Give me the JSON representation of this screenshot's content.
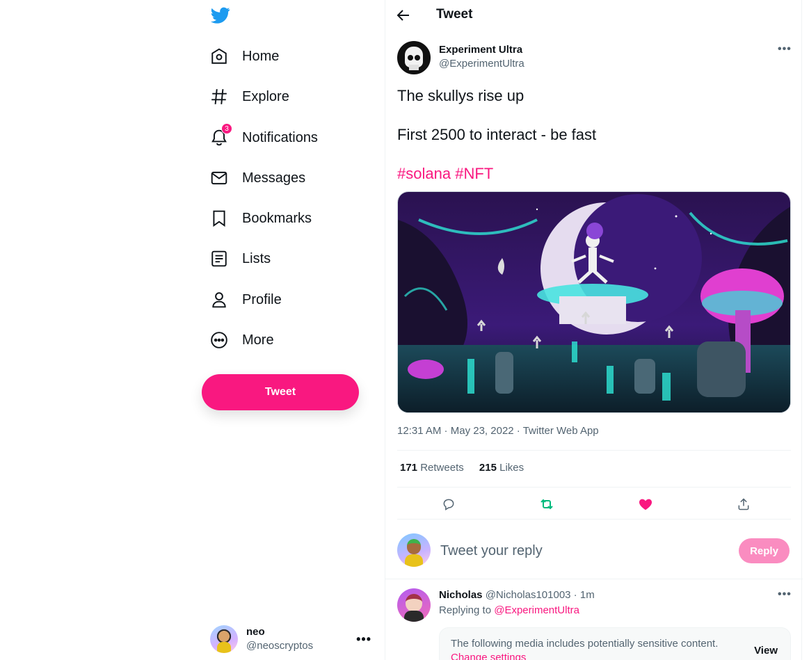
{
  "sidebar": {
    "items": [
      {
        "label": "Home",
        "icon": "home-icon"
      },
      {
        "label": "Explore",
        "icon": "hashtag-icon"
      },
      {
        "label": "Notifications",
        "icon": "bell-icon",
        "badge": "3"
      },
      {
        "label": "Messages",
        "icon": "envelope-icon"
      },
      {
        "label": "Bookmarks",
        "icon": "bookmark-icon"
      },
      {
        "label": "Lists",
        "icon": "list-icon"
      },
      {
        "label": "Profile",
        "icon": "person-icon"
      },
      {
        "label": "More",
        "icon": "more-circle-icon"
      }
    ],
    "tweet_button": "Tweet",
    "account": {
      "name": "neo",
      "handle": "@neoscryptos",
      "more": "•••"
    }
  },
  "header": {
    "title": "Tweet"
  },
  "post": {
    "author_name": "Experiment Ultra",
    "author_handle": "@ExperimentUltra",
    "more": "•••",
    "line1": "The skullys rise up",
    "line2": "First 2500 to interact - be fast",
    "hashtag1": "#solana",
    "hashtag2": "#NFT",
    "time": "12:31 AM",
    "date": "May 23, 2022",
    "source": "Twitter Web App",
    "sep": " · ",
    "retweets_count": "171",
    "retweets_label": "Retweets",
    "likes_count": "215",
    "likes_label": "Likes"
  },
  "reply_box": {
    "placeholder": "Tweet your reply",
    "button": "Reply"
  },
  "replies": [
    {
      "name": "Nicholas",
      "handle": "@Nicholas101003",
      "time": "1m",
      "sep": " · ",
      "replying_prefix": "Replying to ",
      "replying_to": "@ExperimentUltra",
      "more": "•••",
      "sensitive_text": "The following media includes potentially sensitive content.",
      "sensitive_link": "Change settings",
      "view": "View"
    }
  ],
  "colors": {
    "accent": "#f91880",
    "retweet": "#00ba7c",
    "brand": "#1d9bf0"
  }
}
